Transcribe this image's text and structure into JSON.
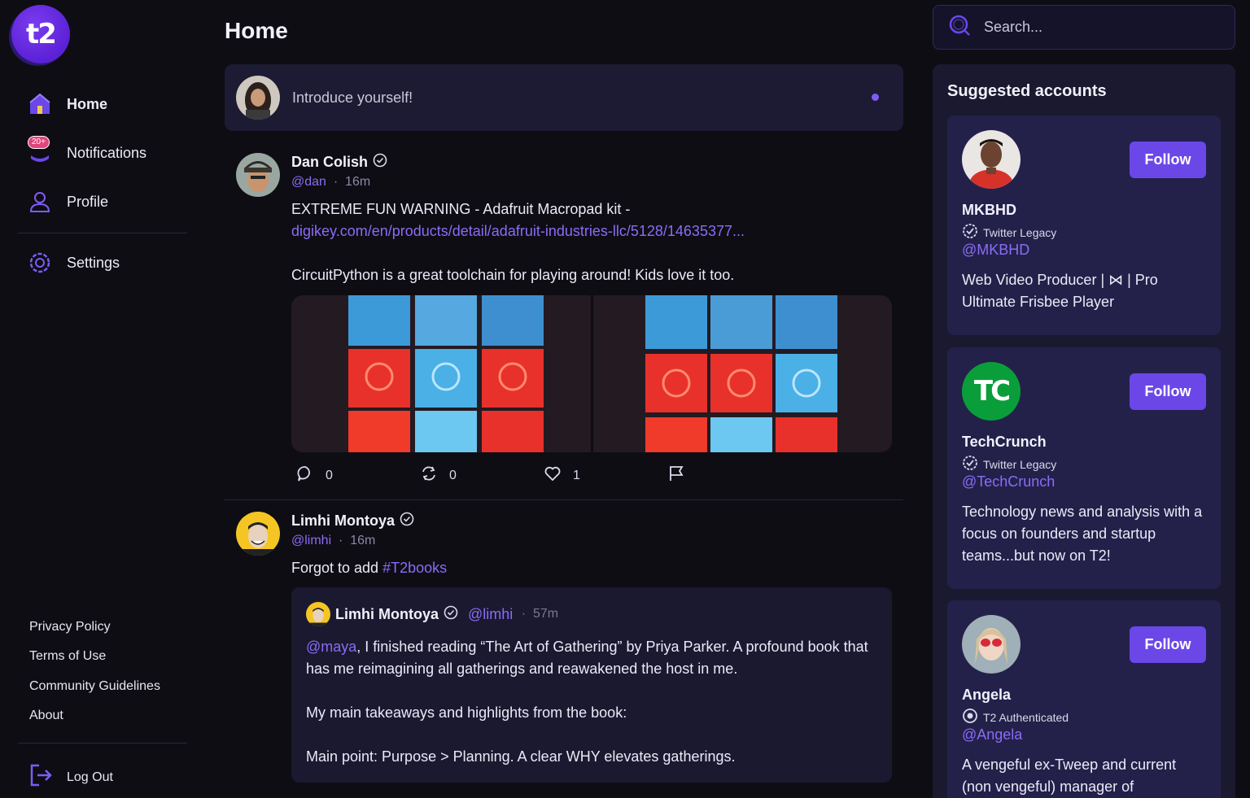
{
  "app": {
    "logo_text": "t2"
  },
  "sidebar": {
    "nav": [
      {
        "label": "Home",
        "icon": "home-icon"
      },
      {
        "label": "Notifications",
        "icon": "bell-icon",
        "badge": "20+"
      },
      {
        "label": "Profile",
        "icon": "user-icon"
      },
      {
        "label": "Settings",
        "icon": "gear-icon"
      }
    ],
    "footer_links": [
      "Privacy Policy",
      "Terms of Use",
      "Community Guidelines",
      "About"
    ],
    "logout_label": "Log Out"
  },
  "main": {
    "title": "Home",
    "composer": {
      "placeholder": "Introduce yourself!"
    },
    "posts": [
      {
        "author": "Dan Colish",
        "handle": "@dan",
        "separator": "·",
        "time": "16m",
        "text_line1": "EXTREME FUN WARNING - Adafruit Macropad kit -",
        "link": "digikey.com/en/products/detail/adafruit-industries-llc/5128/14635377...",
        "text_line2": "CircuitPython is a great toolchain for playing around! Kids love it too.",
        "actions": {
          "replies": "0",
          "reposts": "0",
          "likes": "1"
        }
      },
      {
        "author": "Limhi Montoya",
        "handle": "@limhi",
        "separator": "·",
        "time": "16m",
        "text_prefix": "Forgot to add ",
        "hashtag": "#T2books",
        "quote": {
          "author": "Limhi Montoya",
          "handle": "@limhi",
          "separator": "·",
          "time": "57m",
          "mention": "@maya",
          "line1_rest": ", I finished reading “The Art of Gathering” by Priya Parker. A profound book that has me reimagining all gatherings and reawakened the host in me.",
          "line2": "My main takeaways and highlights from the book:",
          "line3": "Main point: Purpose > Planning. A clear WHY elevates gatherings."
        }
      }
    ]
  },
  "right": {
    "search": {
      "placeholder": "Search..."
    },
    "suggested_title": "Suggested accounts",
    "follow_label": "Follow",
    "accounts": [
      {
        "name": "MKBHD",
        "badge": "Twitter Legacy",
        "handle": "@MKBHD",
        "bio": "Web Video Producer | ⋈ | Pro Ultimate Frisbee Player"
      },
      {
        "name": "TechCrunch",
        "badge": "Twitter Legacy",
        "handle": "@TechCrunch",
        "bio": "Technology news and analysis with a focus on founders and startup teams...but now on T2!",
        "logo_text": "TC"
      },
      {
        "name": "Angela",
        "badge": "T2 Authenticated",
        "handle": "@Angela",
        "bio": "A vengeful ex-Tweep and current (non vengeful) manager of"
      }
    ]
  },
  "colors": {
    "accent": "#6b47e8",
    "link": "#8b6cf6",
    "background": "#0e0d14",
    "card": "#1d1b33"
  }
}
